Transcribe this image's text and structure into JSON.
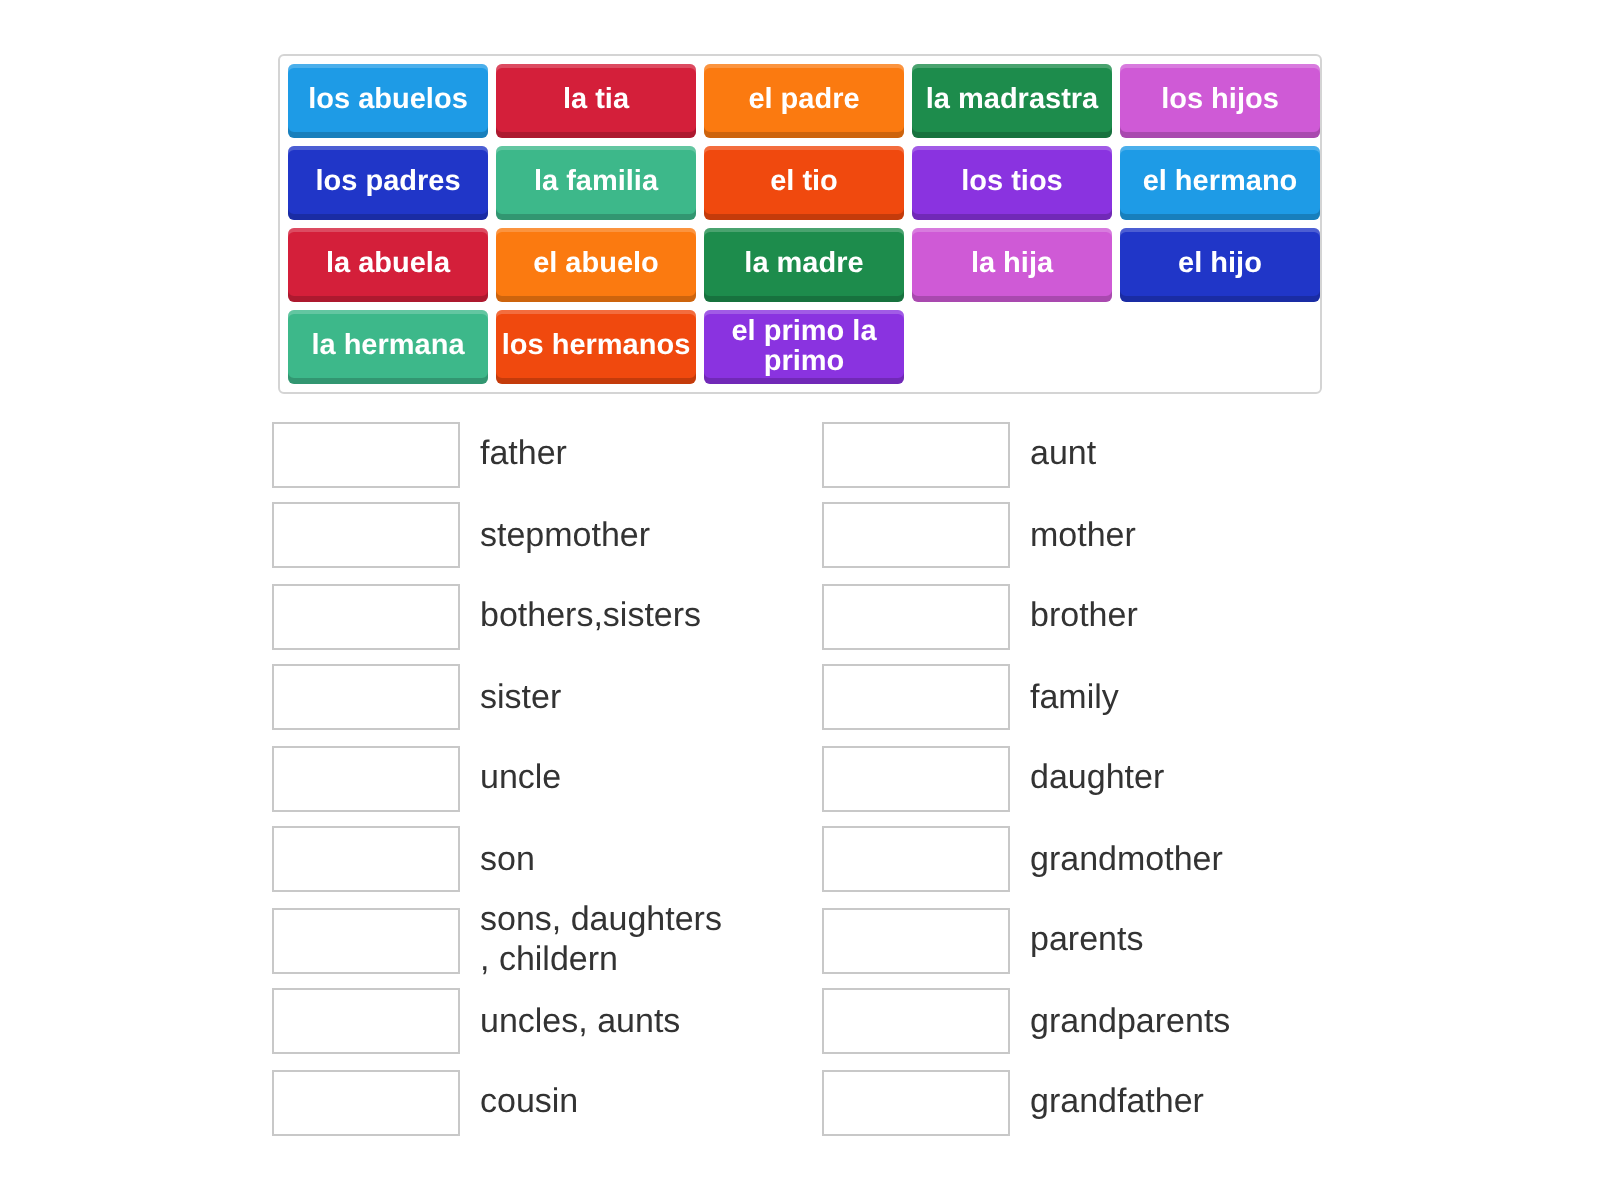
{
  "tiles": [
    {
      "label": "los abuelos",
      "color": "#1e9be6"
    },
    {
      "label": "la tia",
      "color": "#d41f3a"
    },
    {
      "label": "el padre",
      "color": "#fb7a10"
    },
    {
      "label": "la madrastra",
      "color": "#1d8c4c"
    },
    {
      "label": "los hijos",
      "color": "#cf5ad6"
    },
    {
      "label": "los padres",
      "color": "#2036c8"
    },
    {
      "label": "la familia",
      "color": "#3db88a"
    },
    {
      "label": "el tio",
      "color": "#f0490e"
    },
    {
      "label": "los tios",
      "color": "#8a33e0"
    },
    {
      "label": "el hermano",
      "color": "#1e9be6"
    },
    {
      "label": "la abuela",
      "color": "#d41f3a"
    },
    {
      "label": "el abuelo",
      "color": "#fb7a10"
    },
    {
      "label": "la madre",
      "color": "#1d8c4c"
    },
    {
      "label": "la hija",
      "color": "#cf5ad6"
    },
    {
      "label": "el hijo",
      "color": "#2036c8"
    },
    {
      "label": "la hermana",
      "color": "#3db88a"
    },
    {
      "label": "los hermanos",
      "color": "#f0490e"
    },
    {
      "label": "el primo la primo",
      "color": "#8a33e0"
    }
  ],
  "matches": [
    {
      "label": "father"
    },
    {
      "label": "aunt"
    },
    {
      "label": "stepmother"
    },
    {
      "label": "mother"
    },
    {
      "label": "bothers,sisters"
    },
    {
      "label": "brother"
    },
    {
      "label": "sister"
    },
    {
      "label": "family"
    },
    {
      "label": "uncle"
    },
    {
      "label": "daughter"
    },
    {
      "label": "son"
    },
    {
      "label": "grandmother"
    },
    {
      "label": "sons, daughters , childern"
    },
    {
      "label": "parents"
    },
    {
      "label": "uncles, aunts"
    },
    {
      "label": "grandparents"
    },
    {
      "label": "cousin"
    },
    {
      "label": "grandfather"
    }
  ]
}
